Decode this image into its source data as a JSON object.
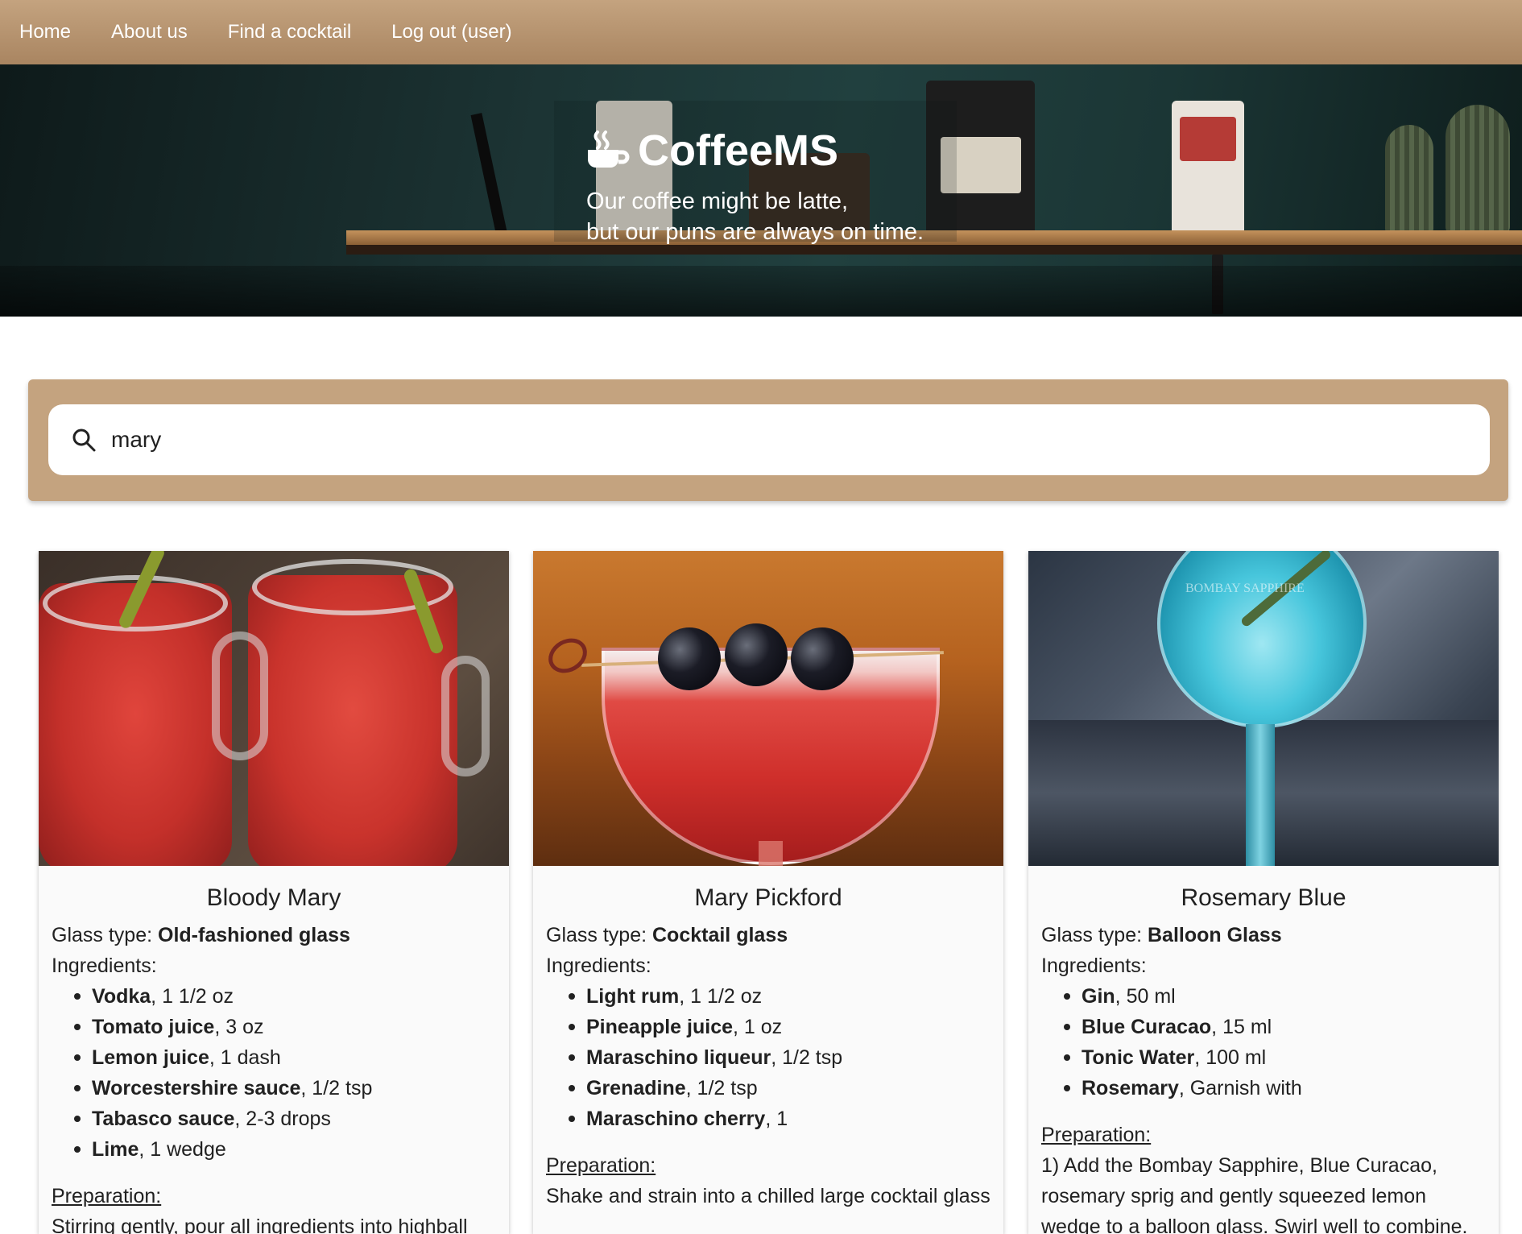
{
  "nav": {
    "items": [
      {
        "label": "Home"
      },
      {
        "label": "About us"
      },
      {
        "label": "Find a cocktail"
      },
      {
        "label": "Log out (user)"
      }
    ]
  },
  "hero": {
    "brand": "CoffeeMS",
    "tagline_line1": "Our coffee might be latte,",
    "tagline_line2": "but our puns are always on time."
  },
  "search": {
    "value": "mary",
    "icon": "search-icon"
  },
  "cards": [
    {
      "title": "Bloody Mary",
      "glass_label": "Glass type: ",
      "glass": "Old-fashioned glass",
      "ingredients_label": "Ingredients:",
      "ingredients": [
        {
          "name": "Vodka",
          "amount": ", 1 1/2 oz"
        },
        {
          "name": "Tomato juice",
          "amount": ", 3 oz"
        },
        {
          "name": "Lemon juice",
          "amount": ", 1 dash"
        },
        {
          "name": "Worcestershire sauce",
          "amount": ", 1/2 tsp"
        },
        {
          "name": "Tabasco sauce",
          "amount": ", 2-3 drops"
        },
        {
          "name": "Lime",
          "amount": ", 1 wedge"
        }
      ],
      "prep_label": "Preparation:",
      "prep": "Stirring gently, pour all ingredients into highball"
    },
    {
      "title": "Mary Pickford",
      "glass_label": "Glass type: ",
      "glass": "Cocktail glass",
      "ingredients_label": "Ingredients:",
      "ingredients": [
        {
          "name": "Light rum",
          "amount": ", 1 1/2 oz"
        },
        {
          "name": "Pineapple juice",
          "amount": ", 1 oz"
        },
        {
          "name": "Maraschino liqueur",
          "amount": ", 1/2 tsp"
        },
        {
          "name": "Grenadine",
          "amount": ", 1/2 tsp"
        },
        {
          "name": "Maraschino cherry",
          "amount": ", 1"
        }
      ],
      "prep_label": "Preparation:",
      "prep": "Shake and strain into a chilled large cocktail glass"
    },
    {
      "title": "Rosemary Blue",
      "glass_label": "Glass type: ",
      "glass": "Balloon Glass",
      "ingredients_label": "Ingredients:",
      "ingredients": [
        {
          "name": "Gin",
          "amount": ", 50 ml"
        },
        {
          "name": "Blue Curacao",
          "amount": ", 15 ml"
        },
        {
          "name": "Tonic Water",
          "amount": ", 100 ml"
        },
        {
          "name": "Rosemary",
          "amount": ", Garnish with"
        }
      ],
      "prep_label": "Preparation:",
      "prep": "1) Add the Bombay Sapphire, Blue Curacao, rosemary sprig and gently squeezed lemon wedge to a balloon glass. Swirl well to combine.",
      "image_etch": "BOMBAY SAPPHIRE"
    }
  ],
  "colors": {
    "nav_bg": "#b8946f",
    "search_panel": "#c4a37f",
    "card_bg": "#fafafa",
    "text": "#212121"
  }
}
